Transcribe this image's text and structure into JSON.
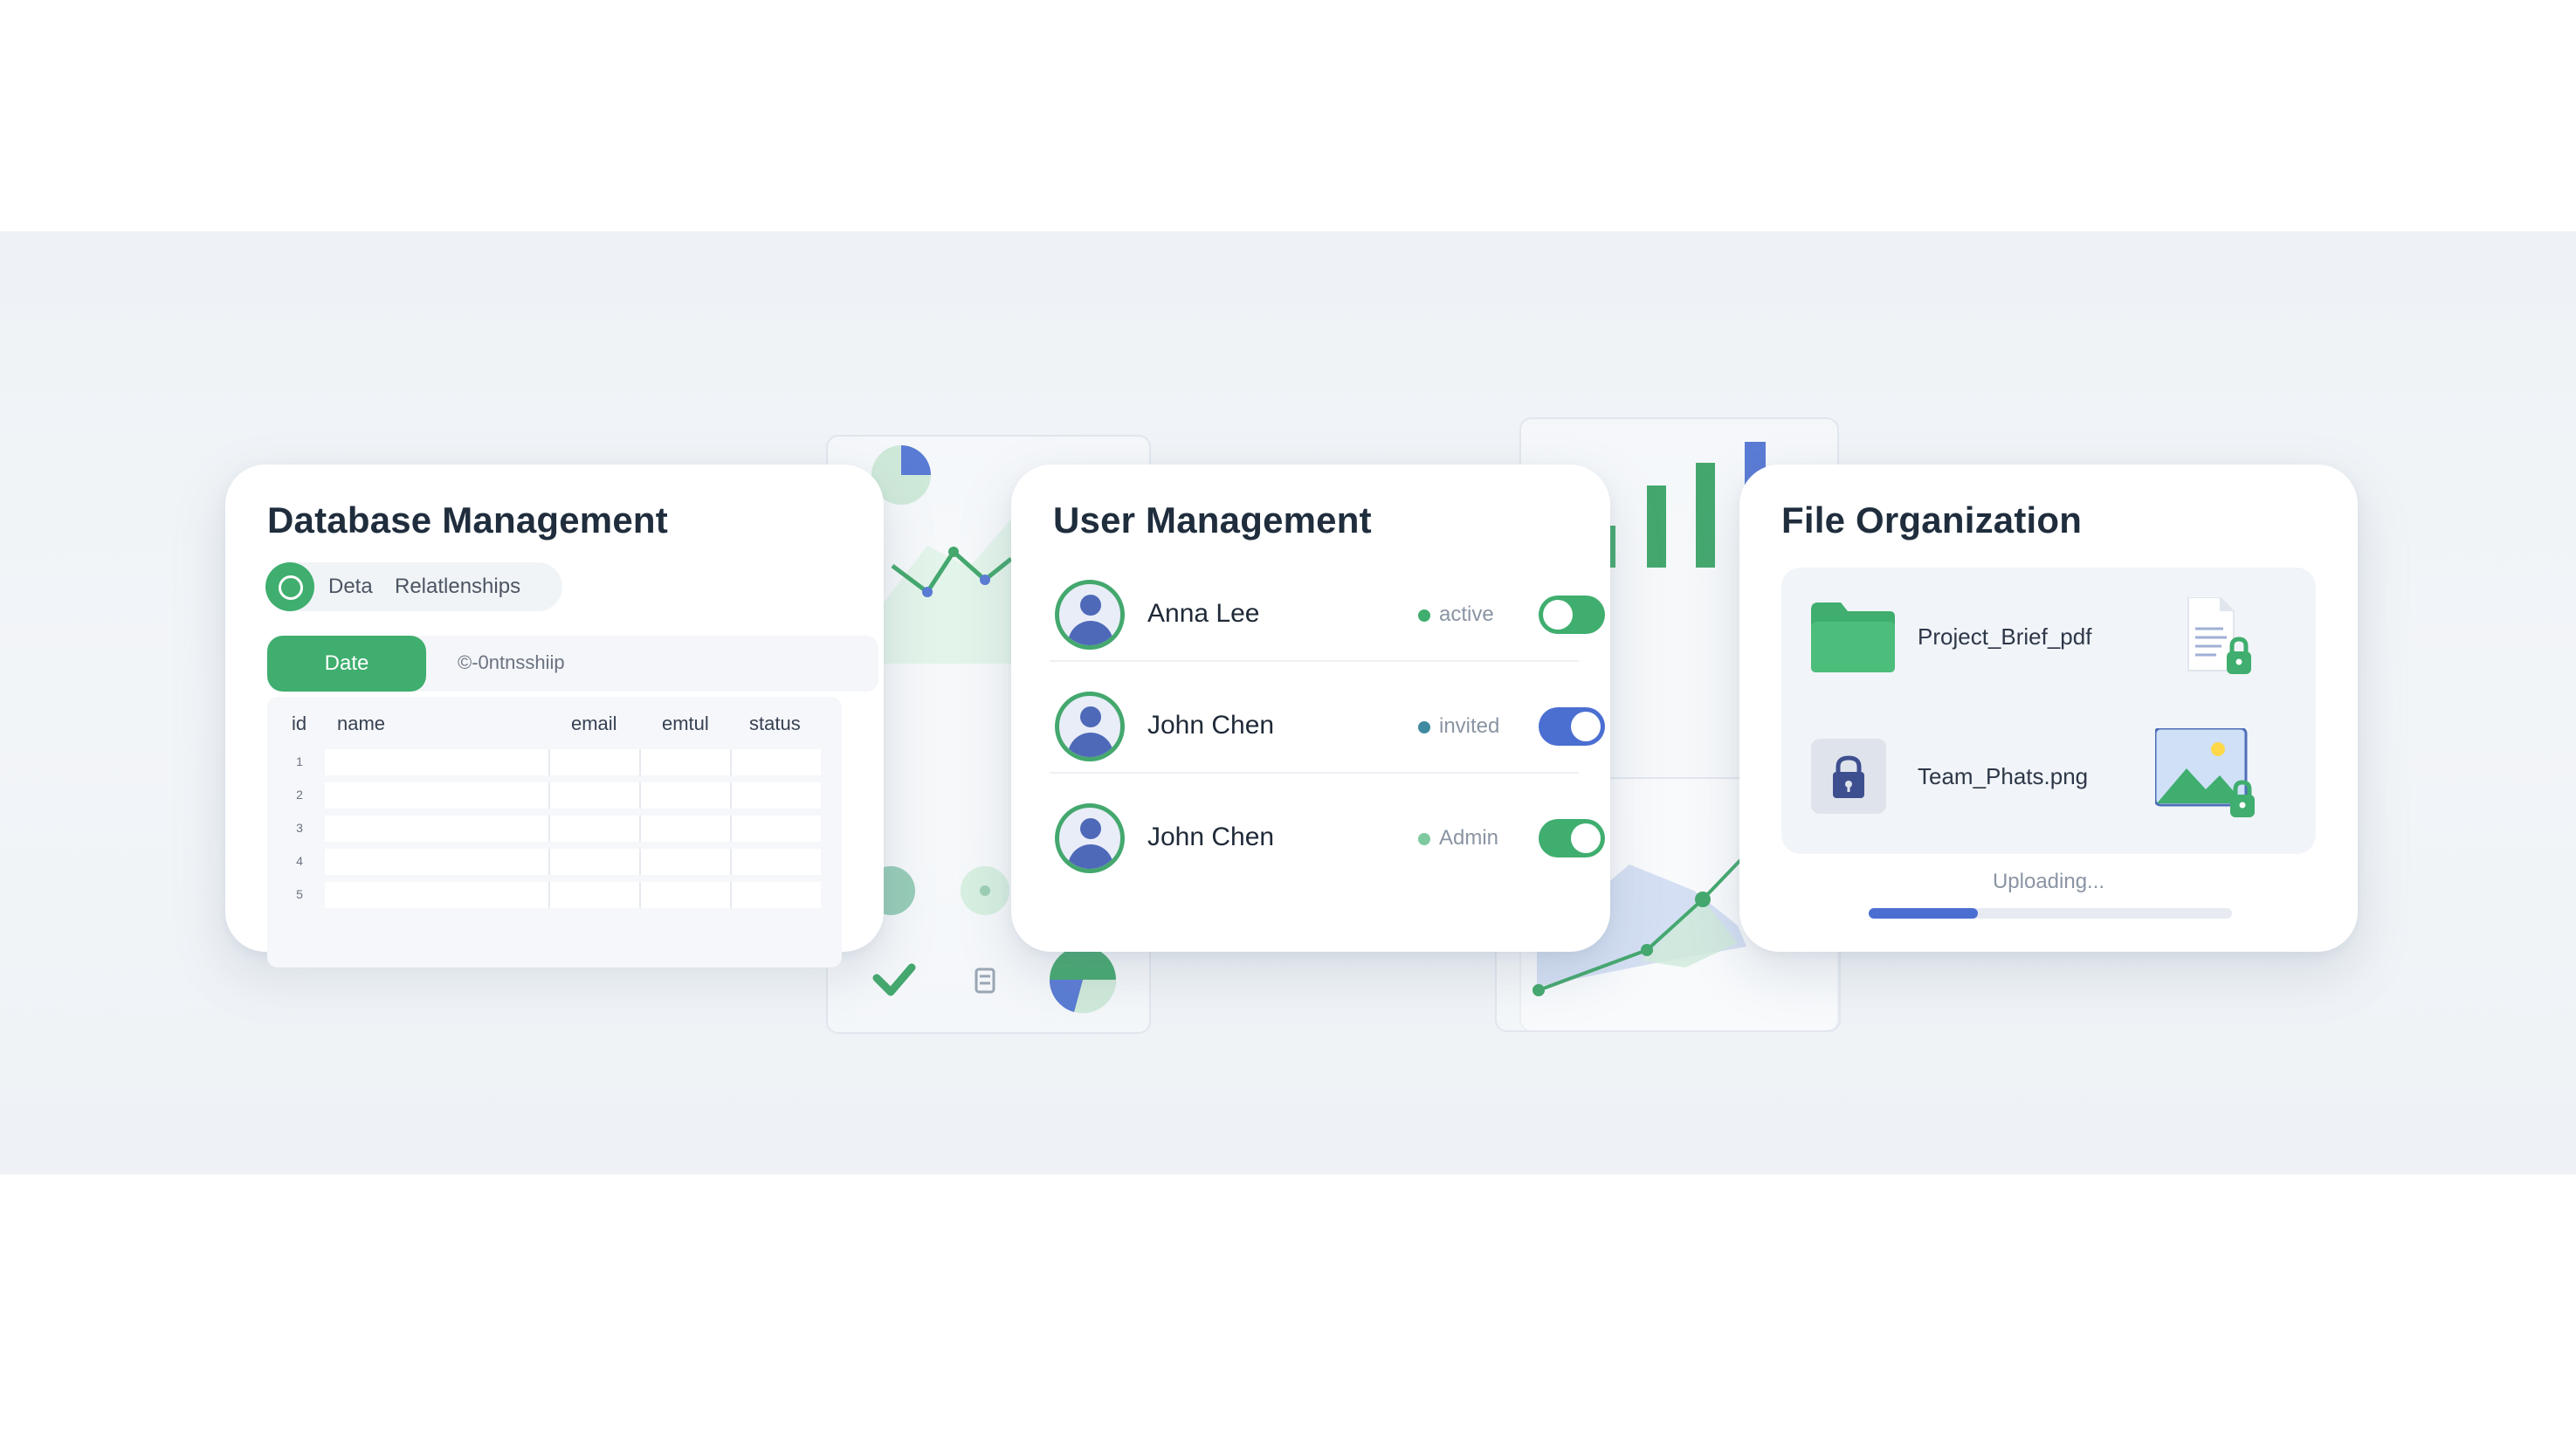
{
  "colors": {
    "accent_green": "#3fae6e",
    "accent_blue": "#4b6fd1",
    "background": "#eef2f6"
  },
  "database": {
    "title": "Database Management",
    "chip_icon": "database-icon",
    "chip_items": [
      "Deta",
      "Relatlenships"
    ],
    "tab_active": "Date",
    "tab_inactive": "©-0ntnsshiip",
    "columns": [
      "id",
      "name",
      "email",
      "emtul",
      "status"
    ],
    "row_numbers": [
      "1",
      "2",
      "3",
      "4",
      "5"
    ]
  },
  "users": {
    "title": "User Management",
    "list": [
      {
        "name": "Anna Lee",
        "status": "active",
        "status_color": "#3fae6e",
        "toggle_color": "#3fae6e",
        "toggle_on": false
      },
      {
        "name": "John Chen",
        "status": "invited",
        "status_color": "#3f8aa0",
        "toggle_color": "#4b6fd1",
        "toggle_on": true
      },
      {
        "name": "John Chen",
        "status": "Admin",
        "status_color": "#7fc9a0",
        "toggle_color": "#3fae6e",
        "toggle_on": true
      }
    ]
  },
  "files": {
    "title": "File Organization",
    "items": [
      {
        "name": "Project_Brief_pdf",
        "icon": "folder-icon",
        "thumb": "document-lock-icon"
      },
      {
        "name": "Team_Phats.png",
        "icon": "lock-icon",
        "thumb": "image-lock-icon"
      }
    ],
    "upload_label": "Uploading...",
    "upload_progress": 0.3
  }
}
